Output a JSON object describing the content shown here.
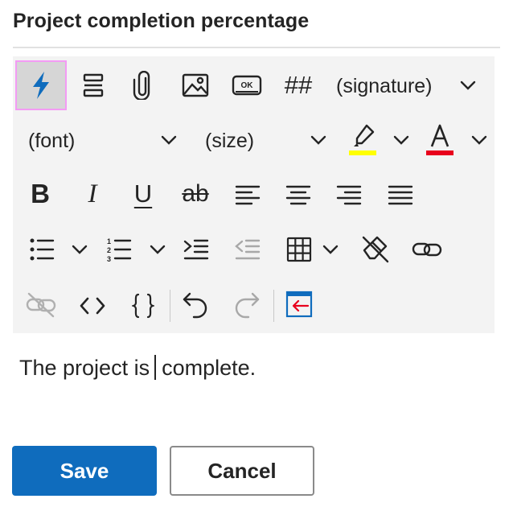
{
  "title": "Project completion percentage",
  "toolbar": {
    "signature_label": "(signature)",
    "font_label": "(font)",
    "size_label": "(size)",
    "ok_badge": "OK",
    "hash_symbol": "##",
    "bold_glyph": "B",
    "italic_glyph": "I",
    "underline_glyph": "U",
    "strike_glyph": "ab",
    "highlight_color": "#ffff00",
    "font_color": "#e8001c",
    "selected_outline_color": "#f39bf4",
    "icons": [
      "lightning-icon",
      "dual-list-icon",
      "paperclip-icon",
      "image-icon",
      "ok-button-icon",
      "hash-icon",
      "signature-dropdown",
      "font-dropdown",
      "size-dropdown",
      "highlighter-icon",
      "font-color-icon",
      "bold-icon",
      "italic-icon",
      "underline-icon",
      "strikethrough-icon",
      "align-left-icon",
      "align-center-icon",
      "align-right-icon",
      "align-justify-icon",
      "bullet-list-icon",
      "numbered-list-icon",
      "indent-icon",
      "outdent-icon",
      "table-icon",
      "clear-format-icon",
      "link-icon",
      "unlink-icon",
      "code-icon",
      "braces-icon",
      "undo-icon",
      "redo-icon",
      "insert-icon"
    ]
  },
  "editor": {
    "text_before": "The project is",
    "text_after": "complete."
  },
  "buttons": {
    "save": "Save",
    "cancel": "Cancel"
  },
  "colors": {
    "primary": "#0f6cbd",
    "toolbar_bg": "#f3f3f3"
  }
}
